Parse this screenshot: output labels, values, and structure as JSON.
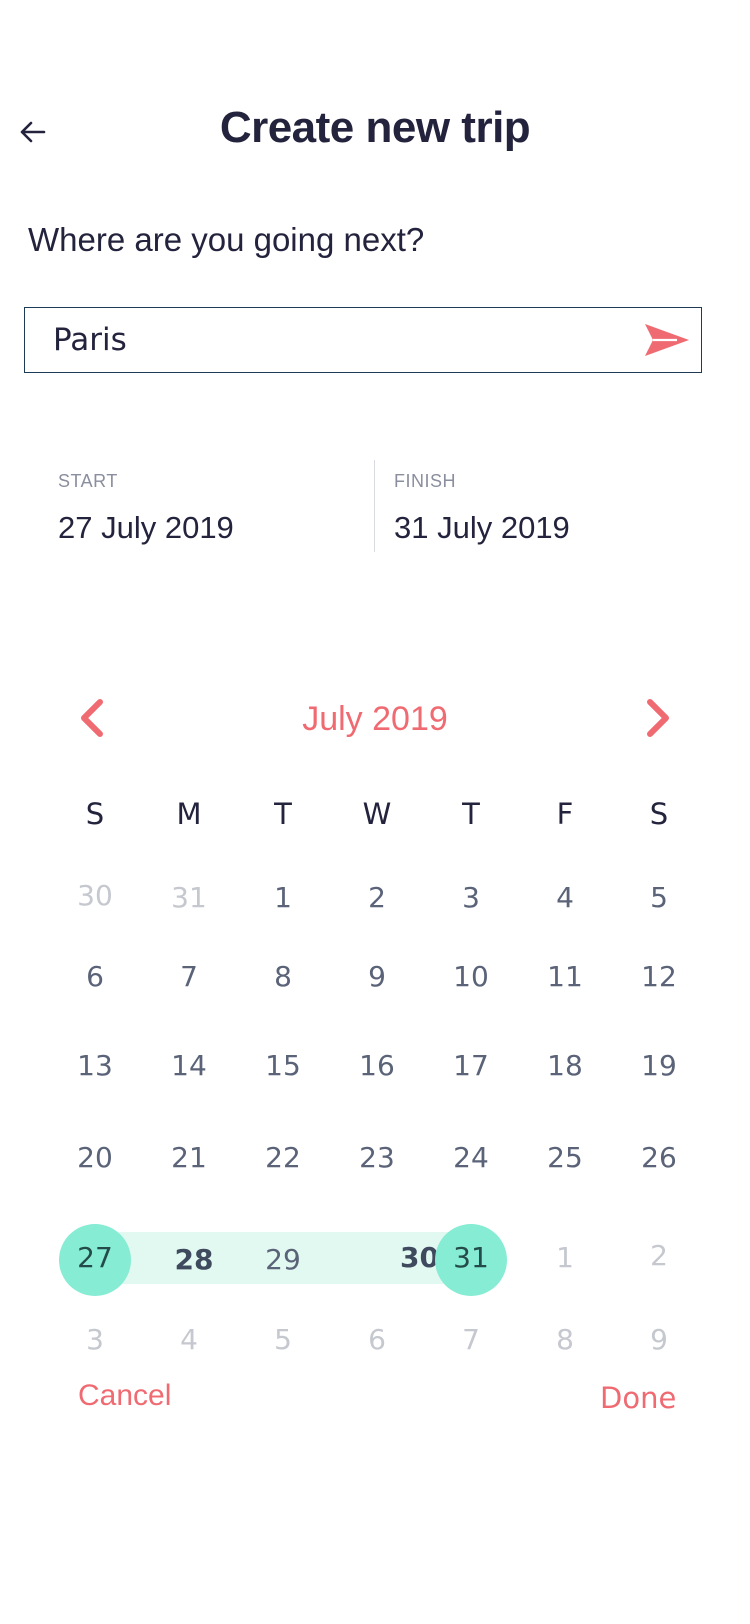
{
  "header": {
    "title": "Create new trip",
    "back_icon": "arrow-left-icon"
  },
  "prompt": {
    "question": "Where are you going next?"
  },
  "search": {
    "value": "Paris",
    "placeholder": "",
    "send_icon": "send-icon"
  },
  "dates": {
    "start_label": "START",
    "start_value": "27 July 2019",
    "finish_label": "FINISH",
    "finish_value": "31 July 2019"
  },
  "calendar": {
    "month_title": "July 2019",
    "prev_icon": "chevron-left-icon",
    "next_icon": "chevron-right-icon",
    "weekdays": [
      "S",
      "M",
      "T",
      "W",
      "T",
      "F",
      "S"
    ],
    "weeks": [
      [
        "30",
        "31",
        "1",
        "2",
        "3",
        "4",
        "5"
      ],
      [
        "6",
        "7",
        "8",
        "9",
        "10",
        "11",
        "12"
      ],
      [
        "13",
        "14",
        "15",
        "16",
        "17",
        "18",
        "19"
      ],
      [
        "20",
        "21",
        "22",
        "23",
        "24",
        "25",
        "26"
      ],
      [
        "27",
        "28",
        "29",
        "30",
        "31",
        "1",
        "2"
      ],
      [
        "3",
        "4",
        "5",
        "6",
        "7",
        "8",
        "9"
      ]
    ]
  },
  "actions": {
    "cancel_label": "Cancel",
    "done_label": "Done"
  },
  "colors": {
    "accent": "#f06a72",
    "selected": "#86ecd4",
    "range": "#e2f9f1",
    "text": "#23233d"
  }
}
